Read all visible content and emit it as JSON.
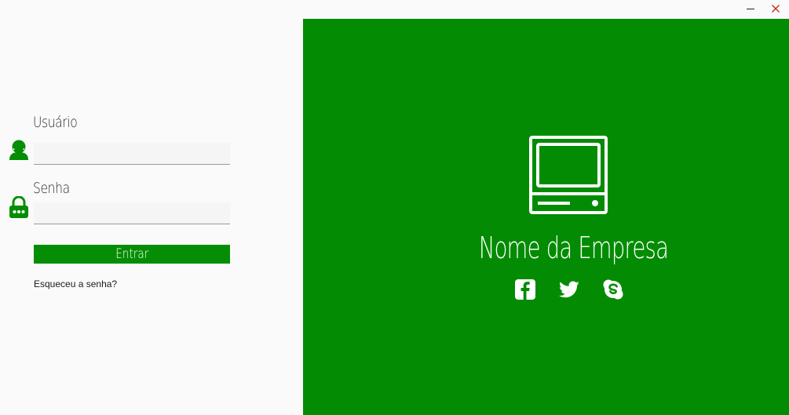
{
  "window": {
    "minimize_symbol": "—",
    "close_symbol": "✕",
    "close_color": "#c42b1c"
  },
  "login": {
    "username_label": "Usuário",
    "username_value": "",
    "password_label": "Senha",
    "password_value": "",
    "submit_label": "Entrar",
    "forgot_label": "Esqueceu a senha?",
    "icons": {
      "username": "user-icon",
      "password": "lock-icon"
    }
  },
  "brand": {
    "company_name": "Nome da Empresa",
    "logo_icon": "computer-icon",
    "social": [
      {
        "name": "facebook-icon"
      },
      {
        "name": "twitter-icon"
      },
      {
        "name": "skype-icon"
      }
    ]
  },
  "colors": {
    "accent": "#058e05",
    "brand_background": "#038c03",
    "page_background": "#fafafa"
  }
}
